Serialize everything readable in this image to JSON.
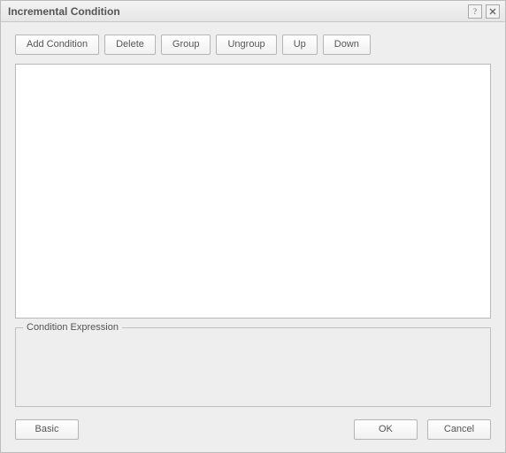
{
  "window": {
    "title": "Incremental Condition"
  },
  "toolbar": {
    "add_condition": "Add Condition",
    "delete": "Delete",
    "group": "Group",
    "ungroup": "Ungroup",
    "up": "Up",
    "down": "Down"
  },
  "fieldset": {
    "legend": "Condition Expression",
    "expression": ""
  },
  "footer": {
    "basic": "Basic",
    "ok": "OK",
    "cancel": "Cancel"
  },
  "icons": {
    "help": "help-icon",
    "close": "close-icon"
  }
}
